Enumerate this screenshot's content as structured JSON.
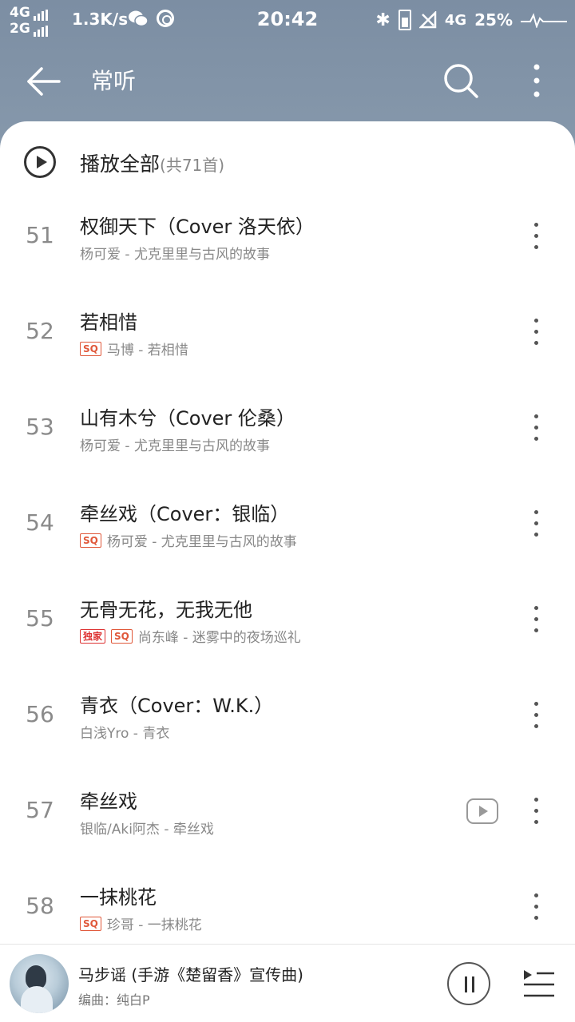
{
  "status_bar": {
    "network_top": "4G",
    "network_bottom": "2G",
    "speed": "1.3K/s",
    "time": "20:42",
    "network_right": "4G",
    "battery": "25%"
  },
  "app_bar": {
    "title": "常听"
  },
  "play_all": {
    "label": "播放全部",
    "count": "(共71首)"
  },
  "songs": [
    {
      "num": "51",
      "title": "权御天下（Cover 洛天依）",
      "sub": "杨可爱 - 尤克里里与古风的故事",
      "badges": []
    },
    {
      "num": "52",
      "title": "若相惜",
      "sub": "马博 - 若相惜",
      "badges": [
        "SQ"
      ]
    },
    {
      "num": "53",
      "title": "山有木兮（Cover 伦桑）",
      "sub": "杨可爱 - 尤克里里与古风的故事",
      "badges": []
    },
    {
      "num": "54",
      "title": "牵丝戏（Cover：银临）",
      "sub": "杨可爱 - 尤克里里与古风的故事",
      "badges": [
        "SQ"
      ]
    },
    {
      "num": "55",
      "title": "无骨无花，无我无他",
      "sub": "尚东峰 - 迷雾中的夜场巡礼",
      "badges": [
        "独家",
        "SQ"
      ]
    },
    {
      "num": "56",
      "title": "青衣（Cover：W.K.）",
      "sub": "白浅Yro - 青衣",
      "badges": []
    },
    {
      "num": "57",
      "title": "牵丝戏",
      "sub": "银临/Aki阿杰 - 牵丝戏",
      "badges": [],
      "mv": true
    },
    {
      "num": "58",
      "title": " 一抹桃花",
      "sub": "珍哥 - 一抹桃花",
      "badges": [
        "SQ"
      ]
    }
  ],
  "player": {
    "title": "马步谣 (手游《楚留香》宣传曲)",
    "sub": "编曲：纯白P"
  }
}
